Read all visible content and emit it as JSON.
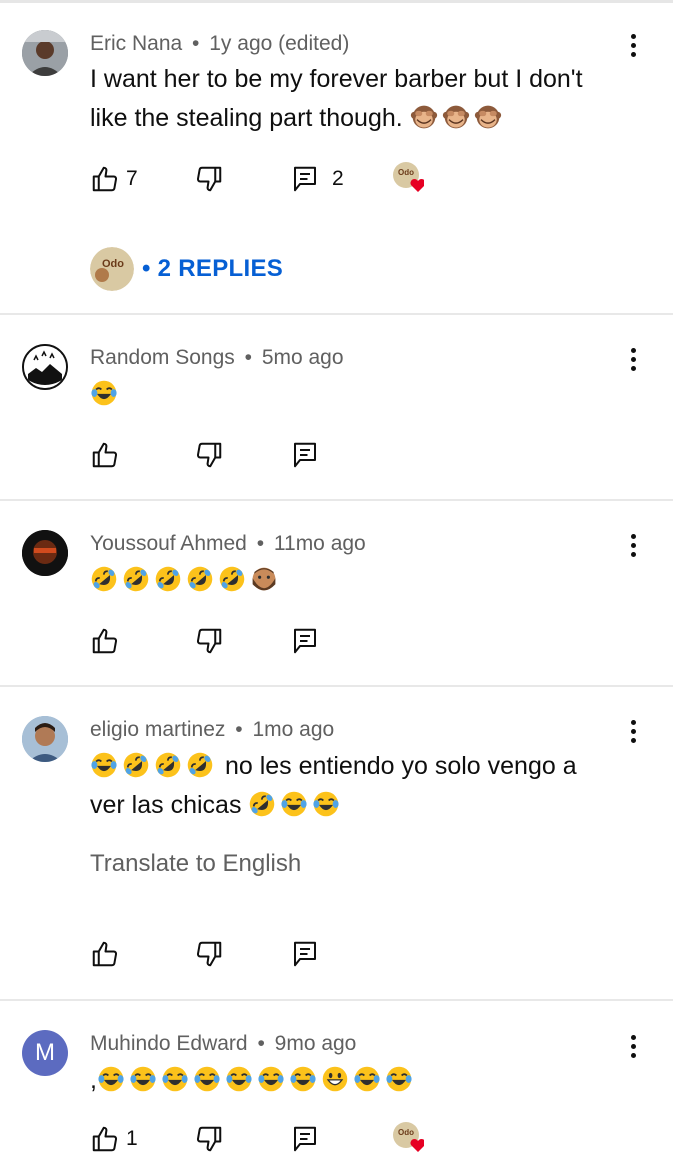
{
  "comments": [
    {
      "author": "Eric Nana",
      "sep": "•",
      "time": "1y ago (edited)",
      "text": "I want her to be my forever barber but I don't like the stealing part though.",
      "emoji_trail": [
        "see-no-evil-monkey",
        "see-no-evil-monkey",
        "see-no-evil-monkey"
      ],
      "likes": "7",
      "replies_count": "2",
      "creator_heart": true,
      "replies_label": "• 2 REPLIES"
    },
    {
      "author": "Random Songs",
      "sep": "•",
      "time": "5mo ago",
      "emoji_trail": [
        "face-with-tears-of-joy"
      ]
    },
    {
      "author": "Youssouf Ahmed",
      "sep": "•",
      "time": "11mo ago",
      "emoji_trail": [
        "rolling-on-floor-laughing",
        "rolling-on-floor-laughing",
        "rolling-on-floor-laughing",
        "rolling-on-floor-laughing",
        "rolling-on-floor-laughing",
        "bearded-person"
      ]
    },
    {
      "author": "eligio martinez",
      "sep": "•",
      "time": "1mo ago",
      "text_a": "no les entiendo yo solo vengo a",
      "text_b": "ver las chicas",
      "translate": "Translate to English"
    },
    {
      "author": "Muhindo Edward",
      "sep": "•",
      "time": "9mo ago",
      "avatar_letter": "M",
      "text_prefix": ",",
      "likes": "1",
      "creator_heart": true
    }
  ],
  "colors": {
    "link_blue": "#065fd4",
    "meta_gray": "#606060",
    "heart_red": "#e60023",
    "avatar_m": "#5c6bc0"
  }
}
